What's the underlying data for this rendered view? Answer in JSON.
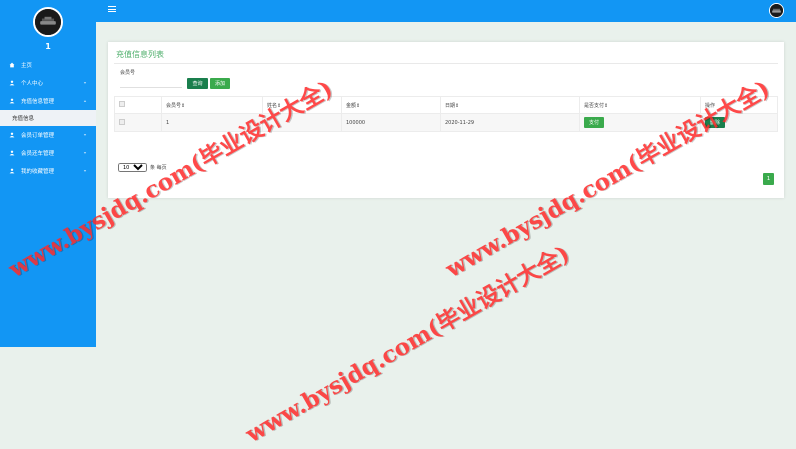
{
  "sidebar": {
    "user_name": "1",
    "menu": [
      {
        "label": "主页",
        "icon": "home-icon",
        "has_caret": false
      },
      {
        "label": "个人中心",
        "icon": "user-icon",
        "has_caret": true
      },
      {
        "label": "充值信息管理",
        "icon": "user-icon",
        "has_caret": true,
        "expanded": true,
        "children": [
          {
            "label": "充值信息"
          }
        ]
      },
      {
        "label": "会员订单管理",
        "icon": "user-icon",
        "has_caret": true
      },
      {
        "label": "会员还车管理",
        "icon": "user-icon",
        "has_caret": true
      },
      {
        "label": "我的收藏管理",
        "icon": "user-icon",
        "has_caret": true
      }
    ]
  },
  "card": {
    "title": "充值信息列表",
    "search": {
      "label": "会员号",
      "value": "",
      "placeholder": ""
    },
    "buttons": {
      "search": "查询",
      "add": "添加"
    },
    "table": {
      "headers": [
        "会员号⇕",
        "姓名⇕",
        "金额⇕",
        "日期⇕",
        "是否支付⇕",
        "操作"
      ],
      "rows": [
        {
          "member_no": "1",
          "name": "",
          "amount": "100000",
          "date": "2020-11-29",
          "pay_button": "支付",
          "delete_button": "删除"
        }
      ]
    },
    "pager": {
      "page_size": "10",
      "per_page_label": "条 每页",
      "current_page": "1"
    }
  },
  "watermark": {
    "text": "www.bysjdq.com(毕业设计大全)"
  },
  "colors": {
    "primary": "#1296f4",
    "green": "#3aaa4c",
    "dark_green": "#1a7f4d",
    "title_green": "#4cae6a",
    "watermark": "#ff2a2a"
  }
}
